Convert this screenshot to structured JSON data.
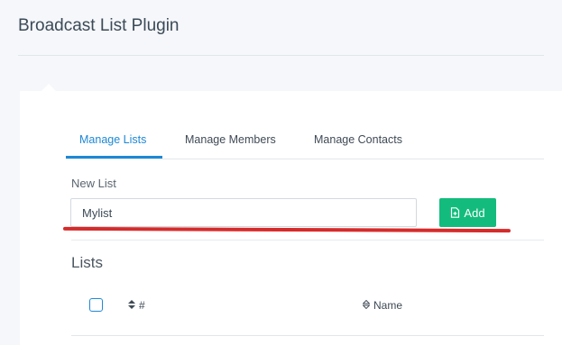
{
  "page": {
    "title": "Broadcast List Plugin"
  },
  "tabs": [
    {
      "label": "Manage Lists",
      "active": true
    },
    {
      "label": "Manage Members",
      "active": false
    },
    {
      "label": "Manage Contacts",
      "active": false
    }
  ],
  "new_list": {
    "label": "New List",
    "value": "Mylist",
    "add_button": {
      "label": "Add",
      "icon": "document-icon"
    }
  },
  "lists": {
    "title": "Lists",
    "columns": [
      {
        "label": "#",
        "icon": "sort-icon"
      },
      {
        "label": "Name",
        "icon": "sort-icon"
      }
    ]
  },
  "colors": {
    "accent": "#1e88d6",
    "add_button": "#13bc7c",
    "annotation": "#d62b2b"
  }
}
